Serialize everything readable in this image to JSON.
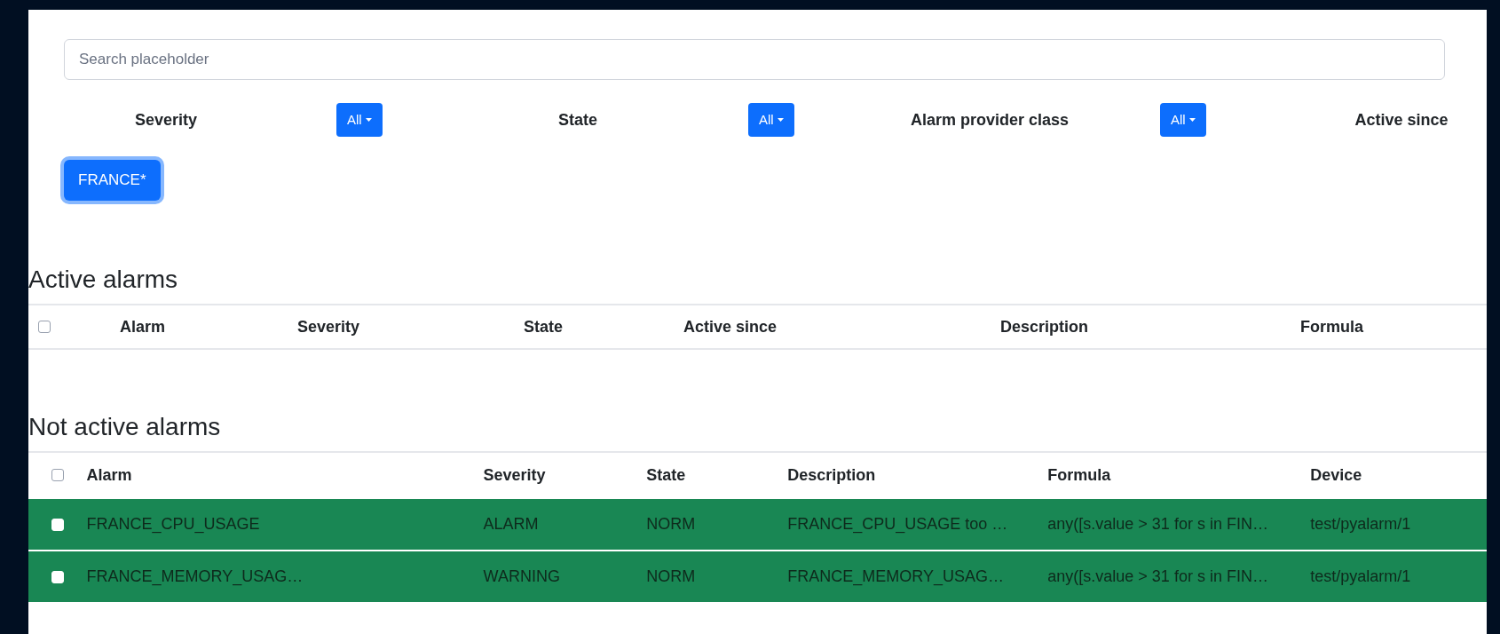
{
  "search": {
    "placeholder": "Search placeholder"
  },
  "filters": [
    {
      "label": "Severity",
      "button": "All"
    },
    {
      "label": "State",
      "button": "All"
    },
    {
      "label": "Alarm provider class",
      "button": "All"
    },
    {
      "label": "Active since"
    }
  ],
  "group_button": {
    "label": "FRANCE*",
    "selected": true
  },
  "active_alarms": {
    "title": "Active alarms",
    "header_checked": false,
    "columns": [
      "Alarm",
      "Severity",
      "State",
      "Active since",
      "Description",
      "Formula"
    ]
  },
  "not_active_alarms": {
    "title": "Not active alarms",
    "header_checked": false,
    "columns": [
      "Alarm",
      "Severity",
      "State",
      "Description",
      "Formula",
      "Device"
    ],
    "rows": [
      {
        "checked": false,
        "highlighted": true,
        "cells": [
          "FRANCE_CPU_USAGE",
          "ALARM",
          "NORM",
          "FRANCE_CPU_USAGE too …",
          "any([s.value > 31 for s in FIN…",
          "test/pyalarm/1"
        ]
      },
      {
        "checked": false,
        "highlighted": true,
        "cells": [
          "FRANCE_MEMORY_USAG…",
          "WARNING",
          "NORM",
          "FRANCE_MEMORY_USAG…",
          "any([s.value > 31 for s in FIN…",
          "test/pyalarm/1"
        ]
      }
    ]
  }
}
